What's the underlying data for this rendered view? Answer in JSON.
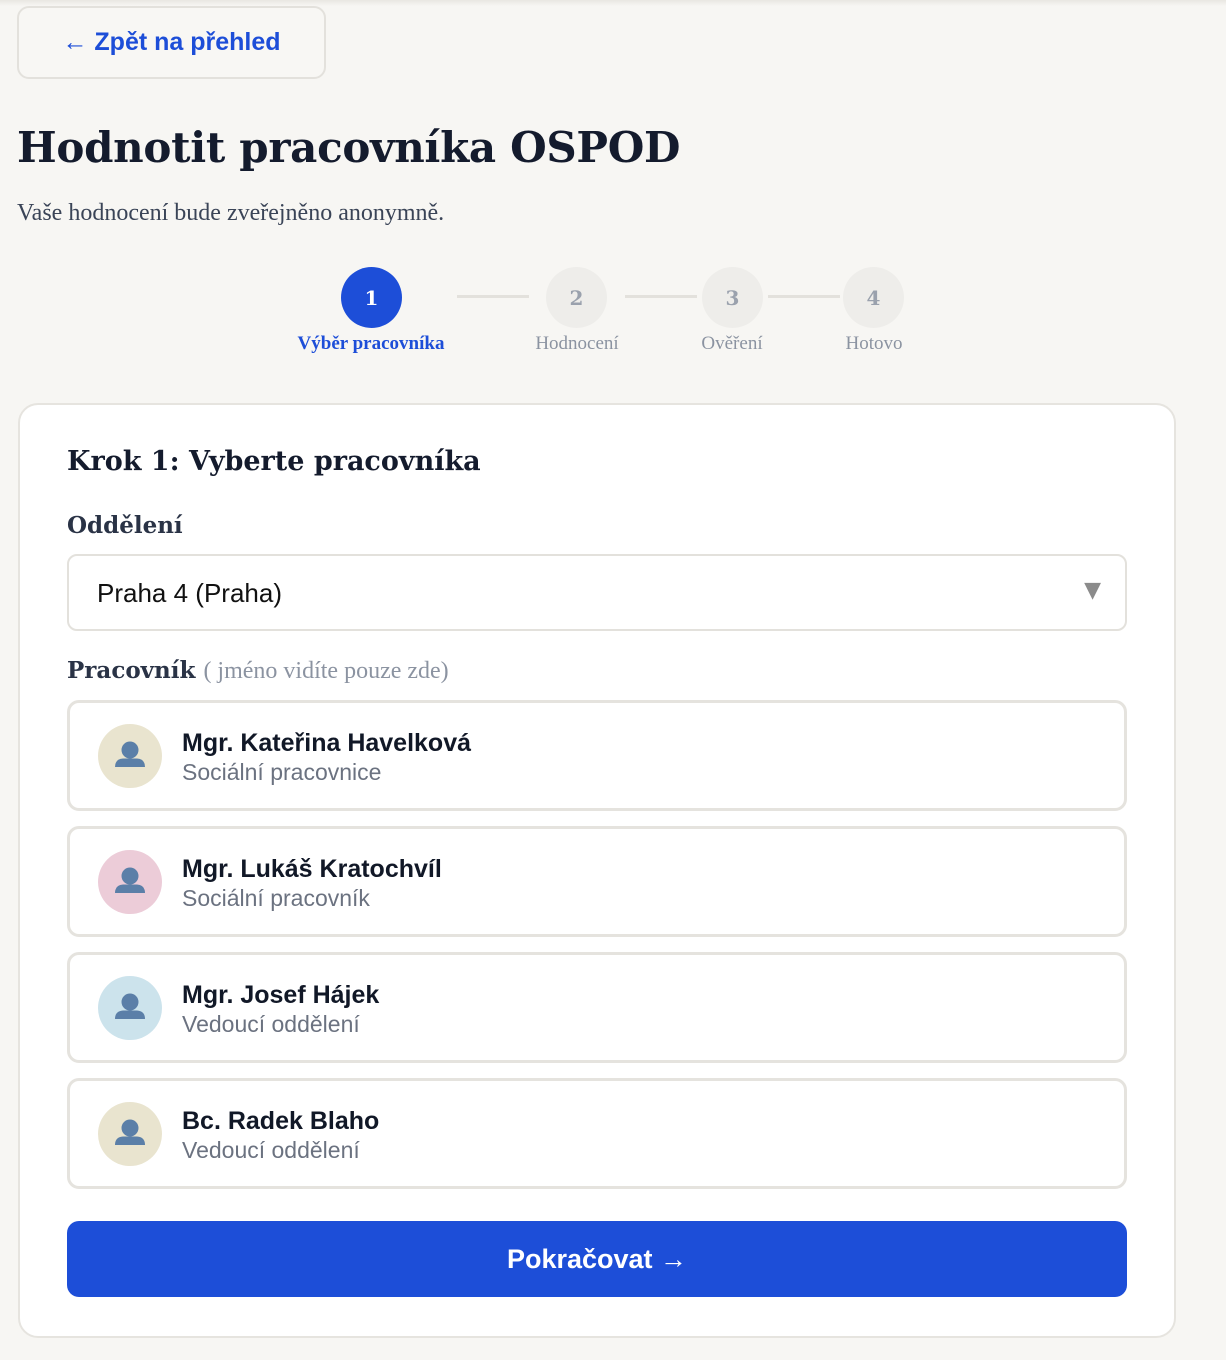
{
  "back_button": {
    "label": "← Zpět na přehled"
  },
  "page": {
    "title": "Hodnotit pracovníka OSPOD",
    "subtitle": "Vaše hodnocení bude zveřejněno anonymně."
  },
  "stepper": {
    "current_step": 1,
    "steps": [
      {
        "number": "1",
        "label": "Výběr pracovníka",
        "state": "active"
      },
      {
        "number": "2",
        "label": "Hodnocení",
        "state": "inactive"
      },
      {
        "number": "3",
        "label": "Ověření",
        "state": "inactive"
      },
      {
        "number": "4",
        "label": "Hotovo",
        "state": "inactive"
      }
    ]
  },
  "form": {
    "step_title": "Krok 1: Vyberte pracovníka",
    "department": {
      "label": "Oddělení",
      "selected": "Praha 4 (Praha)"
    },
    "worker": {
      "label": "Pracovník",
      "hint": "( jméno vidíte pouze zde)"
    },
    "workers": [
      {
        "name": "Mgr. Kateřina Havelková",
        "role": "Sociální pracovnice",
        "avatar_bg": "#e9e4cf",
        "avatar_icon": "person-icon"
      },
      {
        "name": "Mgr. Lukáš Kratochvíl",
        "role": "Sociální pracovník",
        "avatar_bg": "#ecccd8",
        "avatar_icon": "person-icon"
      },
      {
        "name": "Mgr. Josef Hájek",
        "role": "Vedoucí oddělení",
        "avatar_bg": "#cce3ec",
        "avatar_icon": "person-icon"
      },
      {
        "name": "Bc. Radek Blaho",
        "role": "Vedoucí oddělení",
        "avatar_bg": "#e9e4cf",
        "avatar_icon": "person-icon"
      }
    ],
    "continue_label": "Pokračovat →"
  },
  "colors": {
    "accent": "#1d4ed8",
    "background": "#f7f6f3",
    "step_inactive": "#eeedea"
  }
}
